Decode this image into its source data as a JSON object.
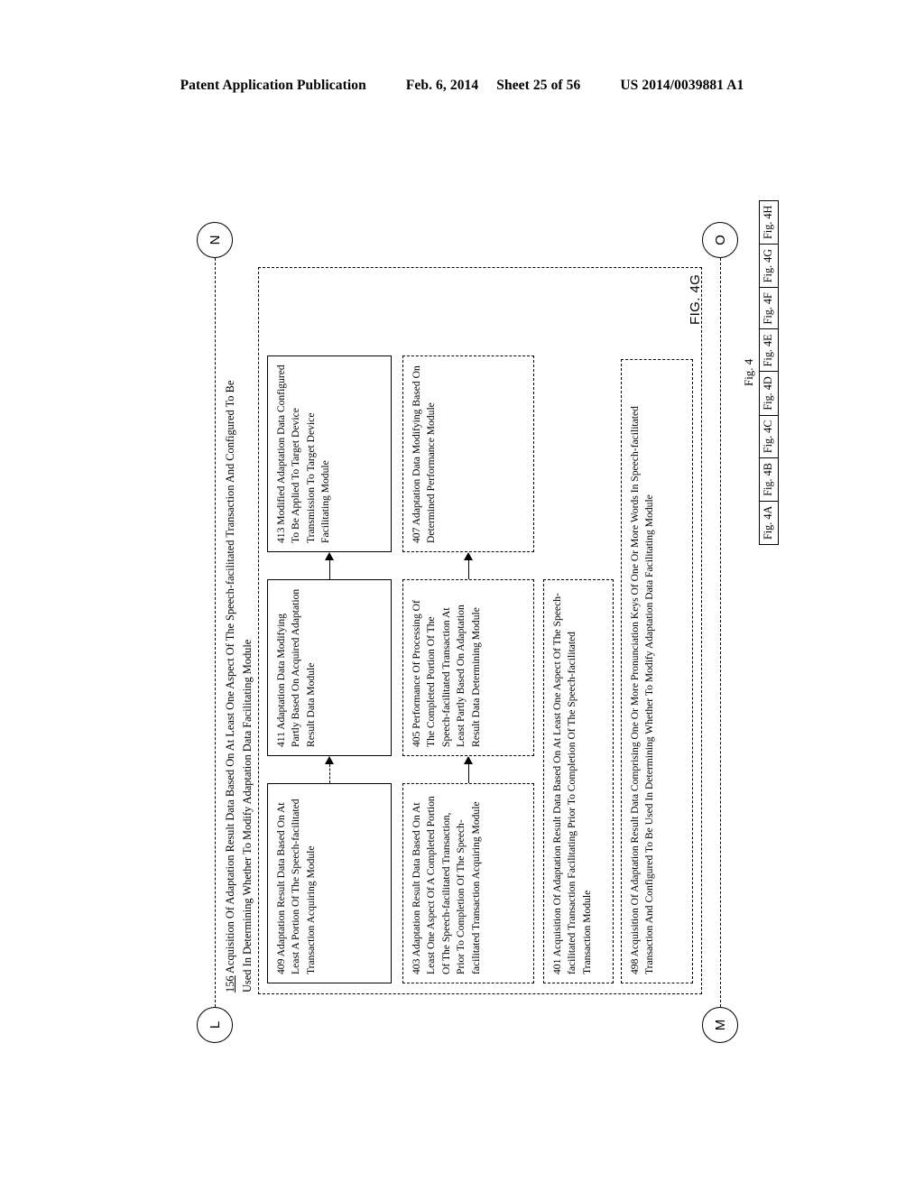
{
  "header": {
    "publication": "Patent Application Publication",
    "date": "Feb. 6, 2014",
    "sheet": "Sheet 25 of 56",
    "patent_number": "US 2014/0039881 A1"
  },
  "figure": {
    "caption": "FIG. 4G",
    "heading_number": "156",
    "heading_text": "Acquisition Of Adaptation Result Data Based On At Least One Aspect Of The Speech-facilitated Transaction And Configured To Be Used In Determining Whether To Modify Adaptation Data Facilitating Module",
    "connectors": [
      {
        "id": "L",
        "label": "L"
      },
      {
        "id": "M",
        "label": "M"
      },
      {
        "id": "N",
        "label": "N"
      },
      {
        "id": "O",
        "label": "O"
      }
    ],
    "boxes": [
      {
        "ref": "409",
        "text": "409 Adaptation Result Data Based On At Least A Portion Of The Speech-facilitated Transaction Acquiring Module",
        "border": "solid"
      },
      {
        "ref": "411",
        "text": "411 Adaptation Data Modifying Partly Based On Acquired Adaptation Result Data Module",
        "border": "solid"
      },
      {
        "ref": "413",
        "text": "413 Modified Adaptation Data Configured To Be Applied To Target Device Transmission To Target Device Facilitating Module",
        "border": "solid"
      },
      {
        "ref": "403",
        "text": "403 Adaptation Result Data Based On At Least One Aspect Of A Completed Portion Of The Speech-facilitated Transaction, Prior To Completion Of The Speech-facilitated Transaction Acquiring Module",
        "border": "dashed"
      },
      {
        "ref": "405",
        "text": "405 Performance Of Processing Of The Completed Portion Of The Speech-facilitated Transaction At Least Partly Based On Adaptation Result Data Determining Module",
        "border": "dashed"
      },
      {
        "ref": "407",
        "text": "407 Adaptation Data Modifying Based On Determined Performance Module",
        "border": "dashed"
      },
      {
        "ref": "401",
        "text": "401 Acquisition Of Adaptation Result Data Based On At Least One Aspect Of The Speech-facilitated Transaction Facilitating Prior To Completion Of The Speech-facilitated Transaction Module",
        "border": "dashed"
      },
      {
        "ref": "498",
        "text": "498 Acquisition Of Adaptation Result Data Comprising One Or More Pronunciation Keys Of One Or More Words In Speech-facilitated Transaction And Configured To Be Used In Determining Whether To Modify Adaptation Data Facilitating Module",
        "border": "dashed"
      }
    ],
    "index": {
      "title": "Fig. 4",
      "cells": [
        "Fig. 4A",
        "Fig. 4B",
        "Fig. 4C",
        "Fig. 4D",
        "Fig. 4E",
        "Fig. 4F",
        "Fig. 4G",
        "Fig. 4H"
      ]
    }
  }
}
